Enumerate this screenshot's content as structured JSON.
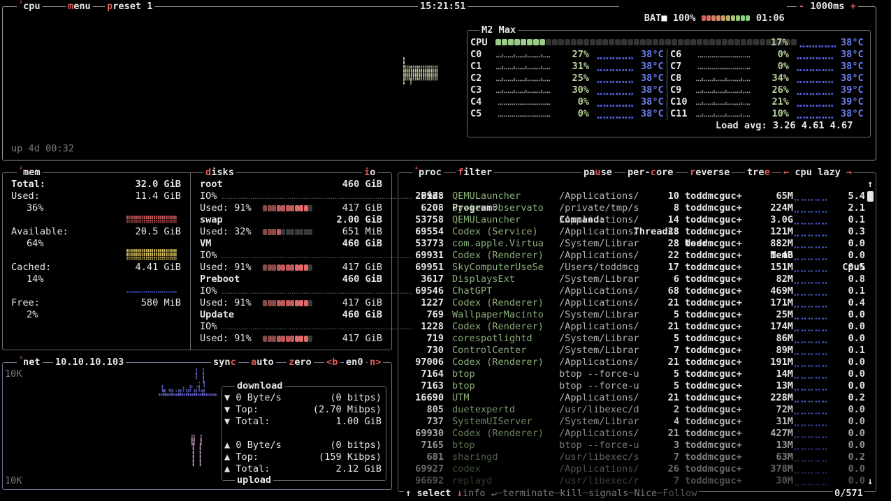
{
  "top": {
    "cpu_tab": "cpu",
    "menu_tab": "menu",
    "preset_tab": "preset 1",
    "time": "15:21:51",
    "battery_label": "BAT",
    "battery_pct": "100%",
    "battery_time": "01:06",
    "minus": "-",
    "interval": "1000ms",
    "plus": "+",
    "uptime": "up 4d 00:32"
  },
  "cpu_panel": {
    "title": "M2 Max",
    "total_label": "CPU",
    "total_pct": "17%",
    "total_temp": "38°C",
    "cores_left": [
      {
        "name": "C0",
        "pct": "27%",
        "temp": "38°C"
      },
      {
        "name": "C1",
        "pct": "31%",
        "temp": "38°C"
      },
      {
        "name": "C2",
        "pct": "25%",
        "temp": "38°C"
      },
      {
        "name": "C3",
        "pct": "30%",
        "temp": "38°C"
      },
      {
        "name": "C4",
        "pct": "0%",
        "temp": "38°C"
      },
      {
        "name": "C5",
        "pct": "0%",
        "temp": "38°C"
      }
    ],
    "cores_right": [
      {
        "name": "C6",
        "pct": "0%",
        "temp": "38°C"
      },
      {
        "name": "C7",
        "pct": "0%",
        "temp": "38°C"
      },
      {
        "name": "C8",
        "pct": "34%",
        "temp": "38°C"
      },
      {
        "name": "C9",
        "pct": "26%",
        "temp": "39°C"
      },
      {
        "name": "C10",
        "pct": "21%",
        "temp": "39°C"
      },
      {
        "name": "C11",
        "pct": "10%",
        "temp": "38°C"
      }
    ],
    "load_avg": "Load avg: 3.26 4.61 4.67"
  },
  "mem": {
    "tab": "mem",
    "total_label": "Total:",
    "total": "32.0 GiB",
    "used_label": "Used:",
    "used": "11.4 GiB",
    "used_pct": "36%",
    "avail_label": "Available:",
    "avail": "20.5 GiB",
    "avail_pct": "64%",
    "cached_label": "Cached:",
    "cached": "4.41 GiB",
    "cached_pct": "14%",
    "free_label": "Free:",
    "free": "580 MiB",
    "free_pct": "2%"
  },
  "disks": {
    "tab": "disks",
    "io_tab": "io",
    "items": [
      {
        "name": "root",
        "size": "460 GiB",
        "io": "IO%",
        "used_label": "Used:",
        "used_pct": "91%",
        "used": "417 GiB"
      },
      {
        "name": "swap",
        "size": "2.00 GiB",
        "io": "",
        "used_label": "Used:",
        "used_pct": "32%",
        "used": "651 MiB"
      },
      {
        "name": "VM",
        "size": "460 GiB",
        "io": "IO%",
        "used_label": "Used:",
        "used_pct": "91%",
        "used": "417 GiB"
      },
      {
        "name": "Preboot",
        "size": "460 GiB",
        "io": "IO%",
        "used_label": "Used:",
        "used_pct": "91%",
        "used": "417 GiB"
      },
      {
        "name": "Update",
        "size": "460 GiB",
        "io": "IO%",
        "used_label": "Used:",
        "used_pct": "91%",
        "used": "417 GiB"
      }
    ]
  },
  "net": {
    "tab": "net",
    "ip": "10.10.10.103",
    "sync": "sync",
    "auto": "auto",
    "zero": "zero",
    "prev": "<b",
    "iface": "en0",
    "next": "n>",
    "scale_top": "10K",
    "scale_bottom": "10K",
    "download_title": "download",
    "upload_title": "upload",
    "dl_rate": "0 Byte/s",
    "dl_bits": "(0 bitps)",
    "dl_top_label": "Top:",
    "dl_top": "(2.70 Mibps)",
    "dl_total_label": "Total:",
    "dl_total": "1.00 GiB",
    "ul_rate": "0 Byte/s",
    "ul_bits": "(0 bitps)",
    "ul_top_label": "Top:",
    "ul_top": "(159 Kibps)",
    "ul_total_label": "Total:",
    "ul_total": "2.12 GiB"
  },
  "proc": {
    "tab": "proc",
    "filter": "filter",
    "pause": "pause",
    "per_core": "per-core",
    "reverse": "reverse",
    "tree": "tree",
    "sort": "cpu lazy",
    "headers": {
      "pid": "Pid:",
      "program": "Program:",
      "command": "Command:",
      "threads": "Threads:",
      "user": "User:",
      "mem": "MemB",
      "cpu": "Cpu%"
    },
    "rows": [
      {
        "pid": "26928",
        "program": "QEMULauncher",
        "command": "/Applications/",
        "threads": "10",
        "user": "toddmcguc+",
        "mem": "65M",
        "cpu": "5.4"
      },
      {
        "pid": "6208",
        "program": "System Observato",
        "command": "/private/tmp/s",
        "threads": "8",
        "user": "toddmcguc+",
        "mem": "224M",
        "cpu": "2.1"
      },
      {
        "pid": "53758",
        "program": "QEMULauncher",
        "command": "/Applications/",
        "threads": "14",
        "user": "toddmcguc+",
        "mem": "3.0G",
        "cpu": "0.1"
      },
      {
        "pid": "69554",
        "program": "Codex (Service)",
        "command": "/Applications/",
        "threads": "28",
        "user": "toddmcguc+",
        "mem": "121M",
        "cpu": "0.3"
      },
      {
        "pid": "53773",
        "program": "com.apple.Virtua",
        "command": "/System/Librar",
        "threads": "28",
        "user": "toddmcguc+",
        "mem": "882M",
        "cpu": "0.0"
      },
      {
        "pid": "69931",
        "program": "Codex (Renderer)",
        "command": "/Applications/",
        "threads": "22",
        "user": "toddmcguc+",
        "mem": "1.4G",
        "cpu": "0.0"
      },
      {
        "pid": "69951",
        "program": "SkyComputerUseSe",
        "command": "/Users/toddmcg",
        "threads": "17",
        "user": "toddmcguc+",
        "mem": "151M",
        "cpu": "0.5"
      },
      {
        "pid": "3617",
        "program": "DisplaysExt",
        "command": "/System/Librar",
        "threads": "6",
        "user": "toddmcguc+",
        "mem": "82M",
        "cpu": "0.8"
      },
      {
        "pid": "69546",
        "program": "ChatGPT",
        "command": "/Applications/",
        "threads": "68",
        "user": "toddmcguc+",
        "mem": "469M",
        "cpu": "0.1"
      },
      {
        "pid": "1227",
        "program": "Codex (Renderer)",
        "command": "/Applications/",
        "threads": "21",
        "user": "toddmcguc+",
        "mem": "171M",
        "cpu": "0.4"
      },
      {
        "pid": "769",
        "program": "WallpaperMacinto",
        "command": "/System/Librar",
        "threads": "5",
        "user": "toddmcguc+",
        "mem": "25M",
        "cpu": "0.0"
      },
      {
        "pid": "1228",
        "program": "Codex (Renderer)",
        "command": "/Applications/",
        "threads": "21",
        "user": "toddmcguc+",
        "mem": "174M",
        "cpu": "0.0"
      },
      {
        "pid": "719",
        "program": "corespotlightd",
        "command": "/System/Librar",
        "threads": "5",
        "user": "toddmcguc+",
        "mem": "86M",
        "cpu": "0.0"
      },
      {
        "pid": "730",
        "program": "ControlCenter",
        "command": "/System/Librar",
        "threads": "7",
        "user": "toddmcguc+",
        "mem": "89M",
        "cpu": "0.1"
      },
      {
        "pid": "97006",
        "program": "Codex (Renderer)",
        "command": "/Applications/",
        "threads": "21",
        "user": "toddmcguc+",
        "mem": "191M",
        "cpu": "0.0"
      },
      {
        "pid": "7164",
        "program": "btop",
        "command": "btop --force-u",
        "threads": "5",
        "user": "toddmcguc+",
        "mem": "14M",
        "cpu": "0.0"
      },
      {
        "pid": "7163",
        "program": "btop",
        "command": "btop --force-u",
        "threads": "5",
        "user": "toddmcguc+",
        "mem": "13M",
        "cpu": "0.0"
      },
      {
        "pid": "16690",
        "program": "UTM",
        "command": "/Applications/",
        "threads": "21",
        "user": "toddmcguc+",
        "mem": "228M",
        "cpu": "0.2"
      },
      {
        "pid": "805",
        "program": "duetexpertd",
        "command": "/usr/libexec/d",
        "threads": "2",
        "user": "toddmcguc+",
        "mem": "72M",
        "cpu": "0.0"
      },
      {
        "pid": "737",
        "program": "SystemUIServer",
        "command": "/System/Librar",
        "threads": "4",
        "user": "toddmcguc+",
        "mem": "31M",
        "cpu": "0.0"
      },
      {
        "pid": "69930",
        "program": "Codex (Renderer)",
        "command": "/Applications/",
        "threads": "21",
        "user": "toddmcguc+",
        "mem": "427M",
        "cpu": "0.0"
      },
      {
        "pid": "7165",
        "program": "btop",
        "command": "btop --force-u",
        "threads": "3",
        "user": "toddmcguc+",
        "mem": "13M",
        "cpu": "0.0"
      },
      {
        "pid": "681",
        "program": "sharingd",
        "command": "/usr/libexec/s",
        "threads": "7",
        "user": "toddmcguc+",
        "mem": "63M",
        "cpu": "0.2"
      },
      {
        "pid": "69927",
        "program": "codex",
        "command": "/Applications/",
        "threads": "26",
        "user": "toddmcguc+",
        "mem": "378M",
        "cpu": "0.0"
      },
      {
        "pid": "96692",
        "program": "replayd",
        "command": "/usr/libexec/r",
        "threads": "7",
        "user": "toddmcguc+",
        "mem": "30M",
        "cpu": "0.0"
      }
    ],
    "footer": {
      "select": "select",
      "info": "info",
      "terminate": "terminate",
      "kill": "kill",
      "signals": "signals",
      "nice": "Nice",
      "follow": "Follow",
      "count": "0/571"
    }
  }
}
